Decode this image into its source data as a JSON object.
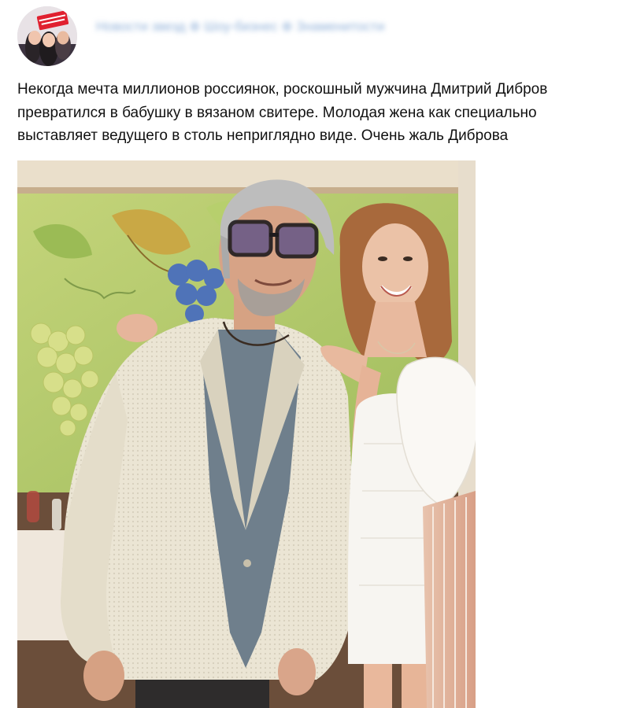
{
  "post": {
    "community_name": "Новости звезд ⊕ Шоу-бизнес ⊕ Знаменитости",
    "text_lines": [
      "Некогда мечта миллионов россиянок, роскошный мужчина Дмитрий Дибров",
      "превратился в бабушку в вязаном свитере. Молодая жена как специально",
      "выставляет ведущего в столь неприглядно виде. Очень жаль Диброва"
    ]
  },
  "colors": {
    "text": "#111111",
    "source_blurred": "#8fb0d8",
    "mural_wall": "#b9cf72",
    "jacket": "#ece6d6",
    "dress": "#f7f5f1"
  },
  "icons": {
    "avatar": "community-avatar"
  }
}
